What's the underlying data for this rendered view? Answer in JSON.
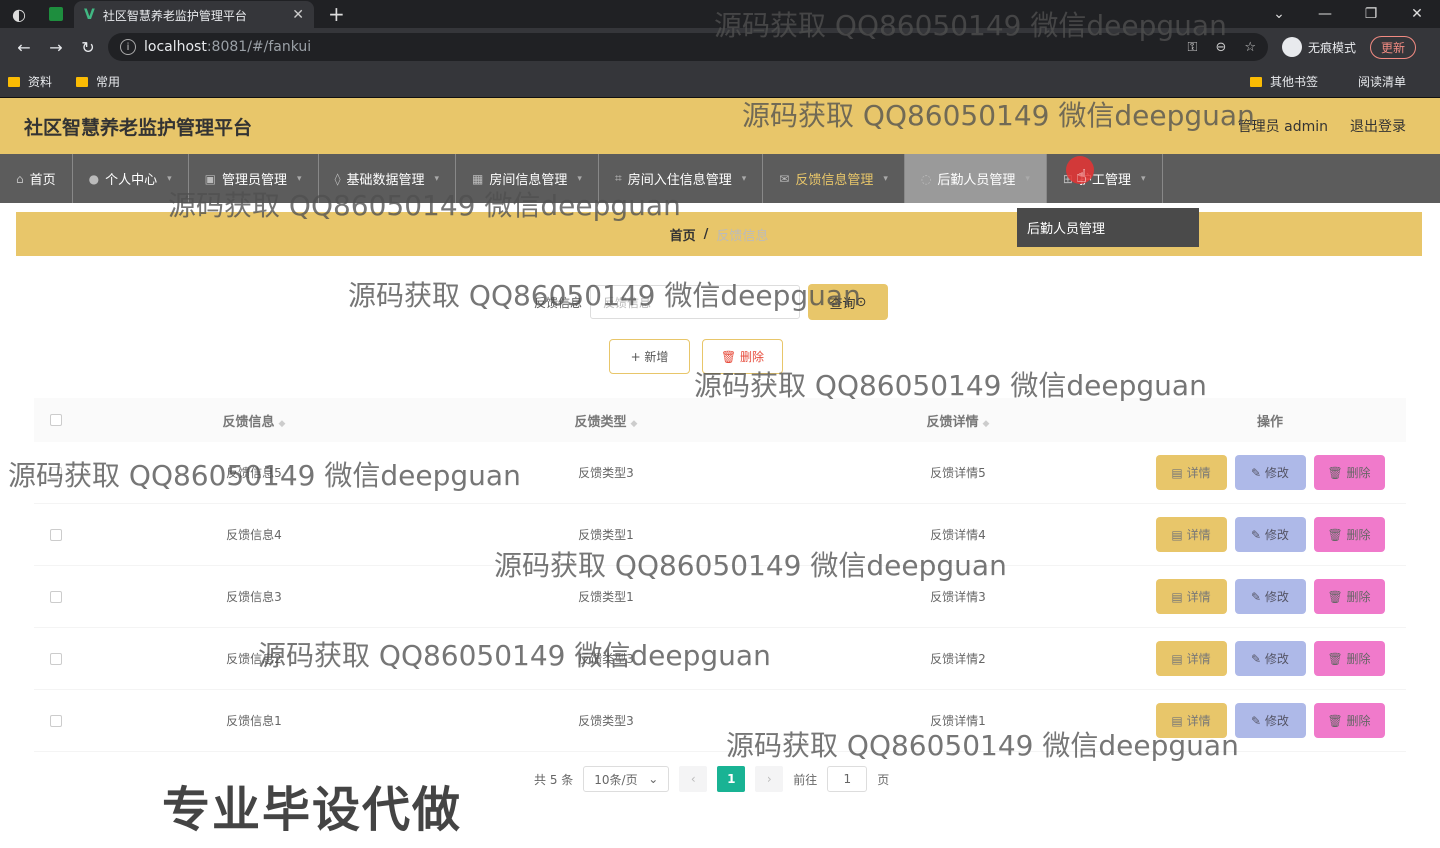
{
  "browser": {
    "tab_title": "社区智慧养老监护管理平台",
    "url_host": "localhost",
    "url_path": ":8081/#/fankui",
    "incognito_label": "无痕模式",
    "update_label": "更新",
    "bookmarks": [
      "资料",
      "常用"
    ],
    "bookmarks_right": [
      "其他书签",
      "阅读清单"
    ]
  },
  "header": {
    "title": "社区智慧养老监护管理平台",
    "user": "管理员 admin",
    "logout": "退出登录"
  },
  "nav": [
    {
      "label": "首页",
      "icon": "home-icon"
    },
    {
      "label": "个人中心",
      "icon": "user-icon"
    },
    {
      "label": "管理员管理",
      "icon": "admin-icon"
    },
    {
      "label": "基础数据管理",
      "icon": "data-icon"
    },
    {
      "label": "房间信息管理",
      "icon": "room-icon"
    },
    {
      "label": "房间入住信息管理",
      "icon": "checkin-icon"
    },
    {
      "label": "反馈信息管理",
      "icon": "feedback-icon"
    },
    {
      "label": "后勤人员管理",
      "icon": "staff-icon"
    },
    {
      "label": "护工管理",
      "icon": "nurse-icon"
    }
  ],
  "dropdown_item": "后勤人员管理",
  "breadcrumb": {
    "home": "首页",
    "current": "反馈信息"
  },
  "search": {
    "label": "反馈信息",
    "placeholder": "反馈信息",
    "button": "查询"
  },
  "actions": {
    "add": "+ 新增",
    "delete": "删除"
  },
  "table": {
    "headers": [
      "反馈信息",
      "反馈类型",
      "反馈详情",
      "操作"
    ],
    "rows": [
      {
        "info": "反馈信息5",
        "type": "反馈类型3",
        "detail": "反馈详情5"
      },
      {
        "info": "反馈信息4",
        "type": "反馈类型1",
        "detail": "反馈详情4"
      },
      {
        "info": "反馈信息3",
        "type": "反馈类型1",
        "detail": "反馈详情3"
      },
      {
        "info": "反馈信息2",
        "type": "反馈类型3",
        "detail": "反馈详情2"
      },
      {
        "info": "反馈信息1",
        "type": "反馈类型3",
        "detail": "反馈详情1"
      }
    ],
    "op_detail": "详情",
    "op_edit": "修改",
    "op_delete": "删除"
  },
  "pager": {
    "total": "共 5 条",
    "size": "10条/页",
    "page": "1",
    "goto": "前往",
    "goto_value": "1",
    "page_unit": "页"
  },
  "watermark": "源码获取 QQ86050149 微信deepguan",
  "overlay": "专业毕设代做"
}
